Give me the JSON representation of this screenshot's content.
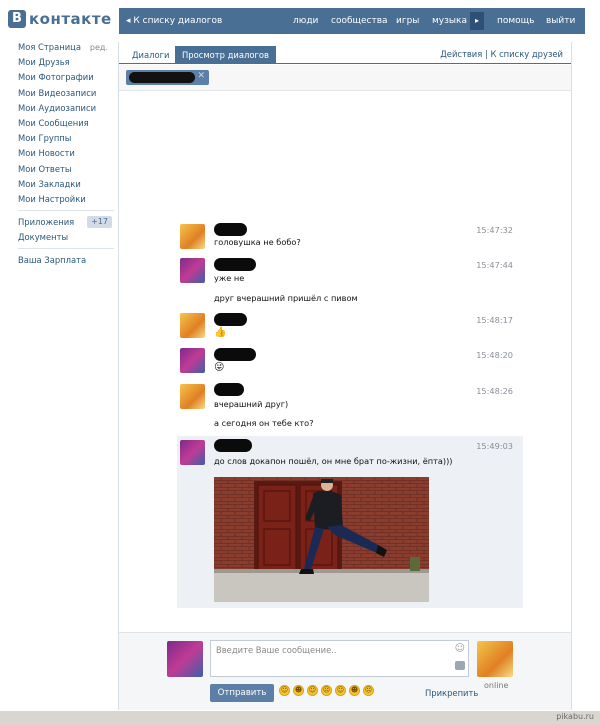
{
  "header": {
    "logo_mark": "B",
    "logo_text": "контакте",
    "back_label": "◂ К списку диалогов",
    "nav": [
      "люди",
      "сообщества",
      "игры",
      "музыка",
      "помощь",
      "выйти"
    ],
    "nav_more": "▸"
  },
  "sidebar": {
    "edit_label": "ред.",
    "items": [
      "Моя Страница",
      "Мои Друзья",
      "Мои Фотографии",
      "Мои Видеозаписи",
      "Мои Аудиозаписи",
      "Мои Сообщения",
      "Мои Группы",
      "Мои Новости",
      "Мои Ответы",
      "Мои Закладки",
      "Мои Настройки"
    ],
    "apps_label": "Приложения",
    "apps_badge": "+17",
    "documents_label": "Документы",
    "salary_label": "Ваша Зарплата"
  },
  "tabs": {
    "dialogs": "Диалоги",
    "view_dialogs": "Просмотр диалогов",
    "actions": "Действия",
    "separator": "|",
    "friends_list": "К списку друзей"
  },
  "chip": {
    "close": "✕"
  },
  "messages": [
    {
      "author": "me",
      "time": "15:47:32",
      "text": "головушка не бобо?"
    },
    {
      "author": "friend",
      "time": "15:47:44",
      "text": "уже не",
      "text2": "друг вчерашний пришёл с пивом"
    },
    {
      "author": "me",
      "time": "15:48:17",
      "emoji": "👍"
    },
    {
      "author": "friend",
      "time": "15:48:20",
      "emoji": "😜"
    },
    {
      "author": "me",
      "time": "15:48:26",
      "text": "вчерашний друг)",
      "text2": "а сегодня он тебе кто?"
    },
    {
      "author": "friend",
      "time": "15:49:03",
      "text": "до слов докапон пошёл, он мне брат по-жизни, ёпта)))",
      "has_photo": true
    }
  ],
  "composer": {
    "placeholder": "Введите Ваше сообщение..",
    "smile_icon": "☺",
    "online": "online",
    "send": "Отправить",
    "attach": "Прикрепить",
    "smileys": [
      "☺",
      "☻",
      "☺",
      "☹",
      "☺",
      "☻",
      "☹"
    ]
  },
  "watermark": "pikabu.ru"
}
